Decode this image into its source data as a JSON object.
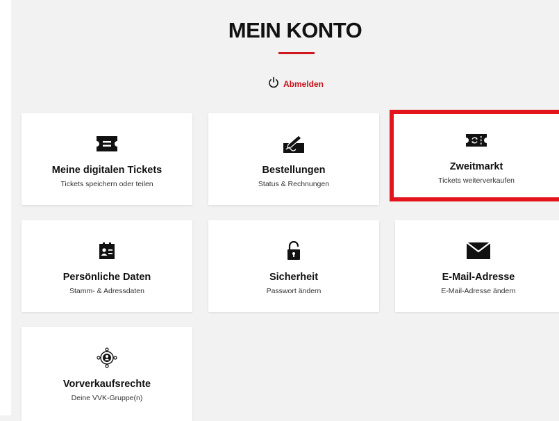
{
  "page": {
    "title": "MEIN KONTO",
    "logout_label": "Abmelden"
  },
  "colors": {
    "accent": "#d0161e",
    "highlight_border": "#e3141c",
    "background": "#f2f2f2"
  },
  "tiles": [
    {
      "title": "Meine digitalen Tickets",
      "subtitle": "Tickets speichern oder teilen",
      "icon": "ticket-icon"
    },
    {
      "title": "Bestellungen",
      "subtitle": "Status & Rechnungen",
      "icon": "signature-icon"
    },
    {
      "title": "Zweitmarkt",
      "subtitle": "Tickets weiterverkaufen",
      "icon": "ticket-exchange-icon"
    },
    {
      "title": "Persönliche Daten",
      "subtitle": "Stamm- & Adressdaten",
      "icon": "id-card-icon"
    },
    {
      "title": "Sicherheit",
      "subtitle": "Passwort ändern",
      "icon": "lock-icon"
    },
    {
      "title": "E-Mail-Adresse",
      "subtitle": "E-Mail-Adresse ändern",
      "icon": "envelope-icon"
    },
    {
      "title": "Vorverkaufsrechte",
      "subtitle": "Deine VVK-Gruppe(n)",
      "icon": "presale-group-icon"
    }
  ]
}
